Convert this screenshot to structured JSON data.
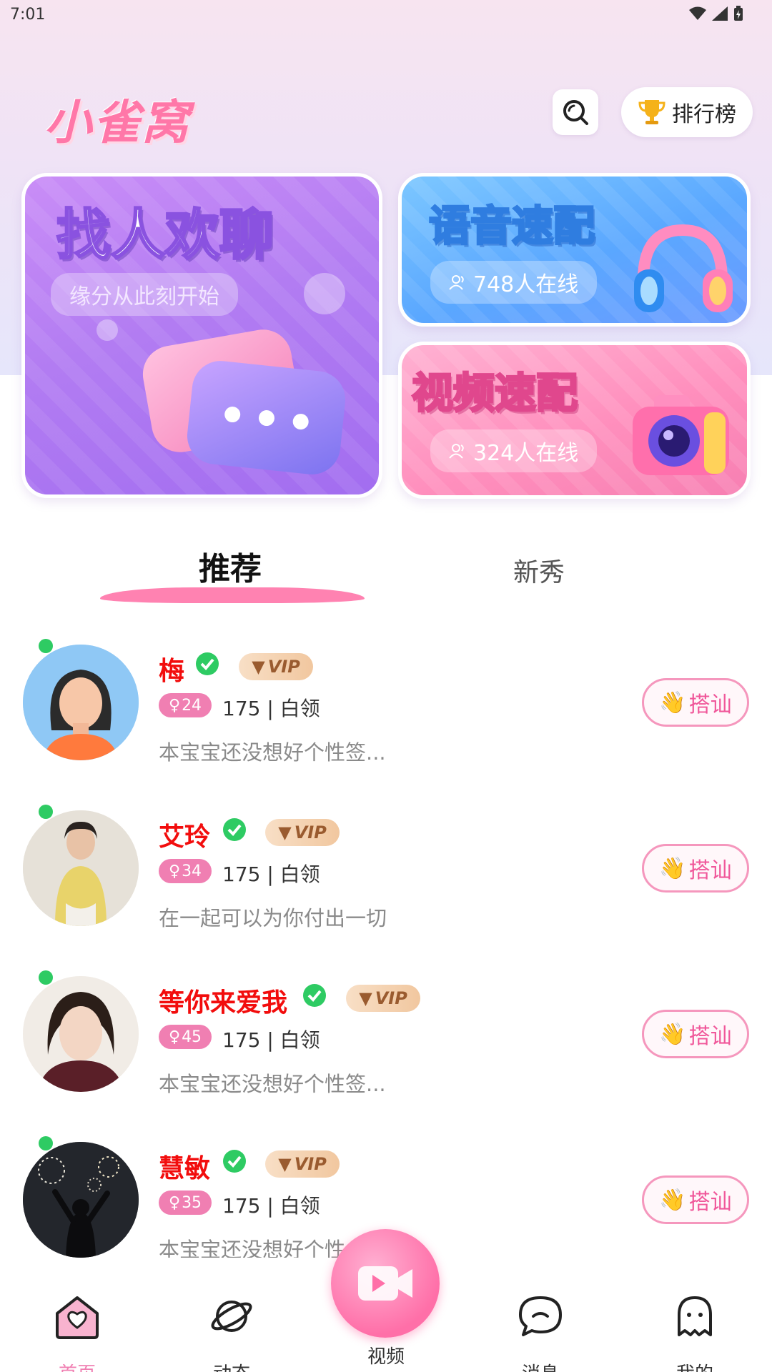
{
  "status_bar": {
    "time": "7:01"
  },
  "header": {
    "app_name": "小雀窝",
    "rank_label": "排行榜"
  },
  "banners": {
    "chat": {
      "title": "找人欢聊",
      "subtitle": "缘分从此刻开始"
    },
    "voice": {
      "title": "语音速配",
      "online": "748人在线"
    },
    "video": {
      "title": "视频速配",
      "online": "324人在线"
    }
  },
  "tabs": [
    {
      "label": "推荐",
      "active": true
    },
    {
      "label": "新秀",
      "active": false
    }
  ],
  "users": [
    {
      "name": "梅",
      "vip": "VIP",
      "age": "24",
      "meta": "175 | 白领",
      "bio": "本宝宝还没想好个性签...",
      "greet": "搭讪",
      "online": true
    },
    {
      "name": "艾玲",
      "vip": "VIP",
      "age": "34",
      "meta": "175 | 白领",
      "bio": "在一起可以为你付出一切",
      "greet": "搭讪",
      "online": true
    },
    {
      "name": "等你来爱我",
      "vip": "VIP",
      "age": "45",
      "meta": "175 | 白领",
      "bio": "本宝宝还没想好个性签...",
      "greet": "搭讪",
      "online": true
    },
    {
      "name": "慧敏",
      "vip": "VIP",
      "age": "35",
      "meta": "175 | 白领",
      "bio": "本宝宝还没想好个性",
      "greet": "搭讪",
      "online": true
    }
  ],
  "bottom_nav": [
    {
      "label": "首页",
      "icon": "home-heart-icon",
      "active": true
    },
    {
      "label": "动态",
      "icon": "planet-icon",
      "active": false
    },
    {
      "label": "视频",
      "icon": "video-camera-icon",
      "active": false
    },
    {
      "label": "消息",
      "icon": "chat-bubble-icon",
      "active": false
    },
    {
      "label": "我的",
      "icon": "ghost-profile-icon",
      "active": false
    }
  ],
  "colors": {
    "accent_pink": "#f07fb2",
    "name_red": "#f20d0d",
    "online_green": "#2ecb63",
    "vip_gold": "#f1c79f"
  }
}
